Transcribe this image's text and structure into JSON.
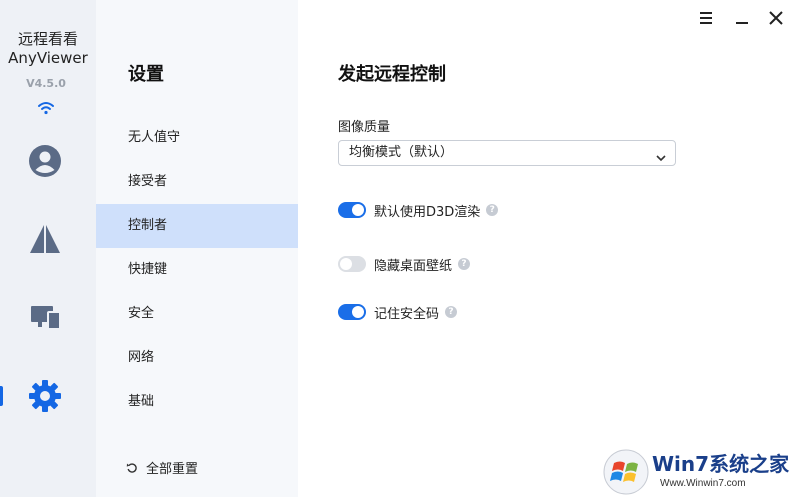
{
  "brand": {
    "name_cn": "远程看看",
    "name_en": "AnyViewer",
    "version": "V4.5.0"
  },
  "rail": {
    "icons": [
      "account-icon",
      "connect-icon",
      "devices-icon",
      "settings-icon"
    ],
    "active": "settings-icon",
    "accent_color": "#1467e4"
  },
  "nav": {
    "title": "设置",
    "items": [
      {
        "label": "无人值守",
        "active": false
      },
      {
        "label": "接受者",
        "active": false
      },
      {
        "label": "控制者",
        "active": true
      },
      {
        "label": "快捷键",
        "active": false
      },
      {
        "label": "安全",
        "active": false
      },
      {
        "label": "网络",
        "active": false
      },
      {
        "label": "基础",
        "active": false
      }
    ],
    "reset_label": "全部重置"
  },
  "main": {
    "title": "发起远程控制",
    "image_quality": {
      "label": "图像质量",
      "selected": "均衡模式（默认）"
    },
    "toggles": [
      {
        "label": "默认使用D3D渲染",
        "on": true
      },
      {
        "label": "隐藏桌面壁纸",
        "on": false
      },
      {
        "label": "记住安全码",
        "on": true
      }
    ]
  },
  "window_controls": [
    "menu-icon",
    "minimize-icon",
    "close-icon"
  ],
  "watermark": {
    "title": "Win7系统之家",
    "url": "Www.Winwin7.com"
  }
}
